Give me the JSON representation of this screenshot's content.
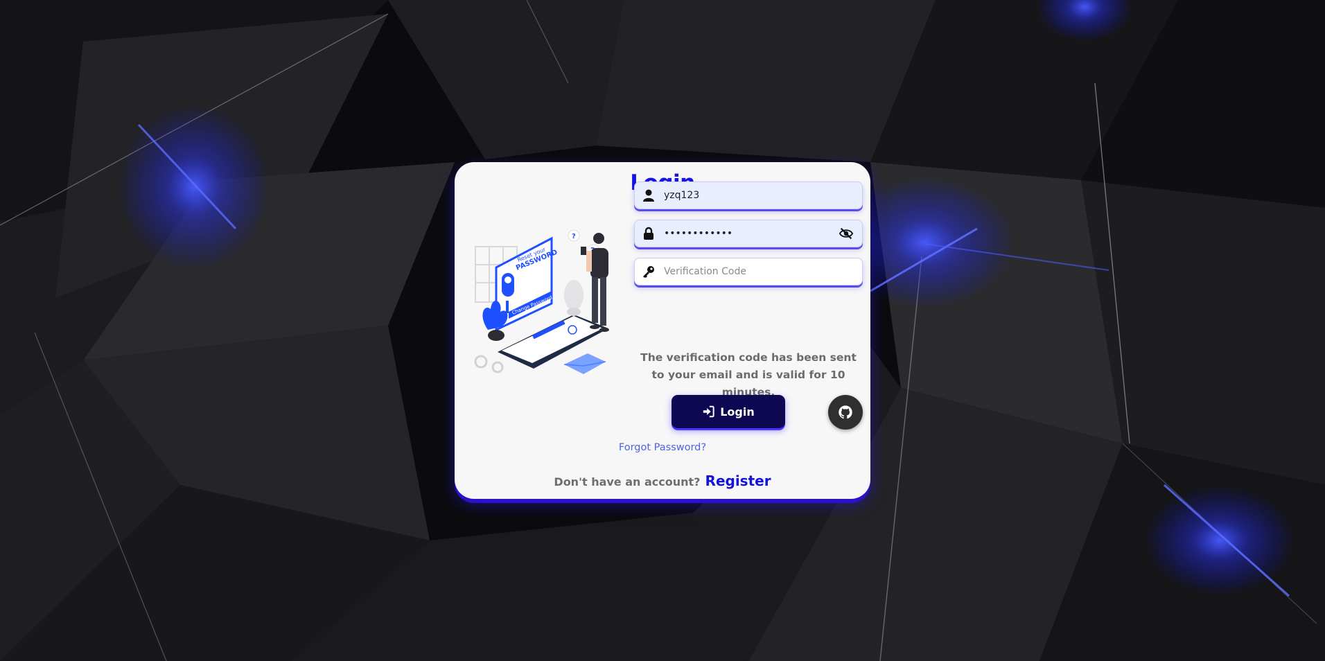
{
  "login_card": {
    "title": "Login",
    "username": {
      "value": "yzq123",
      "icon": "user-icon"
    },
    "password": {
      "value": "••••••••••••",
      "icon": "lock-icon",
      "toggle_icon": "eye-slash-icon"
    },
    "verification": {
      "placeholder": "Verification Code",
      "value": "",
      "icon": "key-icon"
    },
    "note": "The verification code has been sent to your email and is valid for 10 minutes.",
    "login_button": {
      "label": "Login",
      "icon": "sign-in-icon"
    },
    "github_button": {
      "icon": "github-icon"
    },
    "forgot_password": "Forgot Password?",
    "register_prompt": "Don't have an account?",
    "register_link": "Register"
  },
  "illustration": {
    "icon": "reset-password-illustration",
    "text_lines": [
      "Reset your",
      "PASSWORD",
      "Change Password"
    ]
  },
  "colors": {
    "accent": "#1414e6",
    "button_bg": "#0e0752",
    "link": "#5061e6",
    "background": "#0b0b0d",
    "glow": "#2a3bff"
  }
}
